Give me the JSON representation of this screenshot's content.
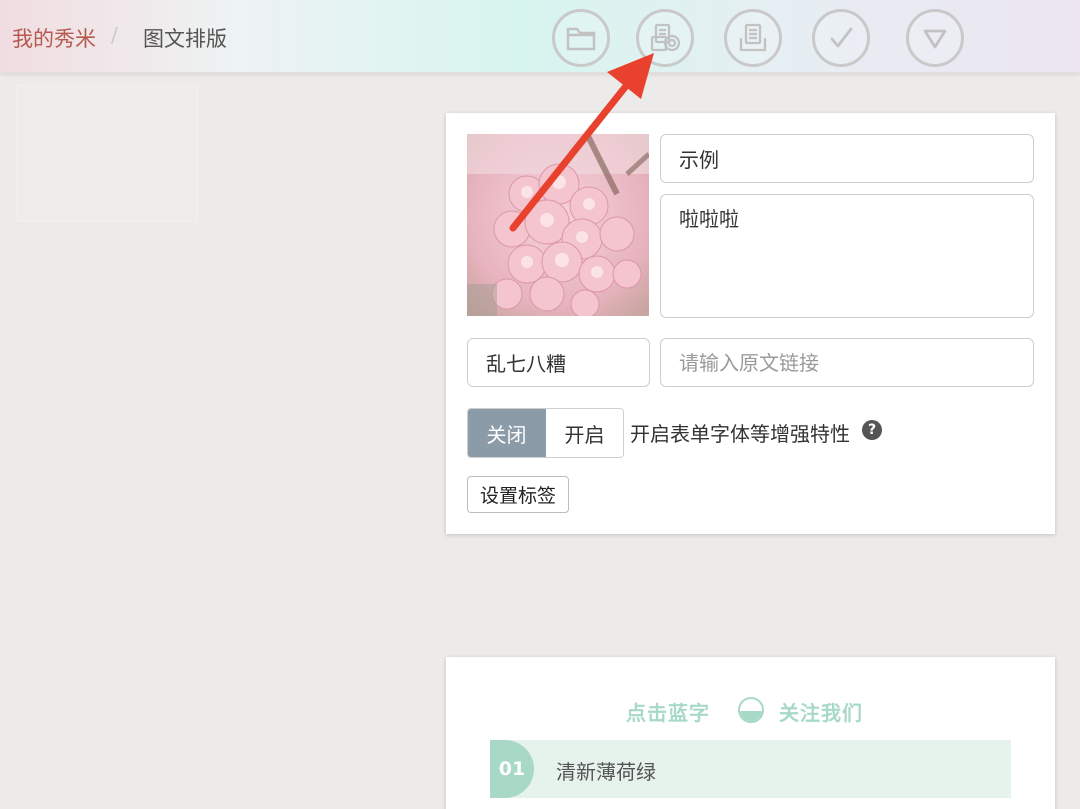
{
  "breadcrumb": {
    "root": "我的秀米",
    "separator": "/",
    "current": "图文排版"
  },
  "toolbar": {
    "buttons": [
      {
        "icon": "folder-icon"
      },
      {
        "icon": "cover-image-icon"
      },
      {
        "icon": "document-icon"
      },
      {
        "icon": "checkmark-icon"
      },
      {
        "icon": "triangle-down-icon"
      }
    ]
  },
  "editor": {
    "title_value": "示例",
    "digest_value": "啦啦啦",
    "author_value": "乱七八糟",
    "link_placeholder": "请输入原文链接",
    "toggle_off_label": "关闭",
    "toggle_on_label": "开启",
    "toggle_description": "开启表单字体等增强特性",
    "help_glyph": "?",
    "set_tags_label": "设置标签"
  },
  "preview": {
    "follow_left": "点击蓝字",
    "follow_right": "关注我们",
    "section_number": "01",
    "section_title": "清新薄荷绿"
  },
  "colors": {
    "accent_mint": "#a7d9c6",
    "toggle_active": "#8c9ba8",
    "annotation_arrow": "#e8422e",
    "breadcrumb_root": "#b65a50"
  }
}
